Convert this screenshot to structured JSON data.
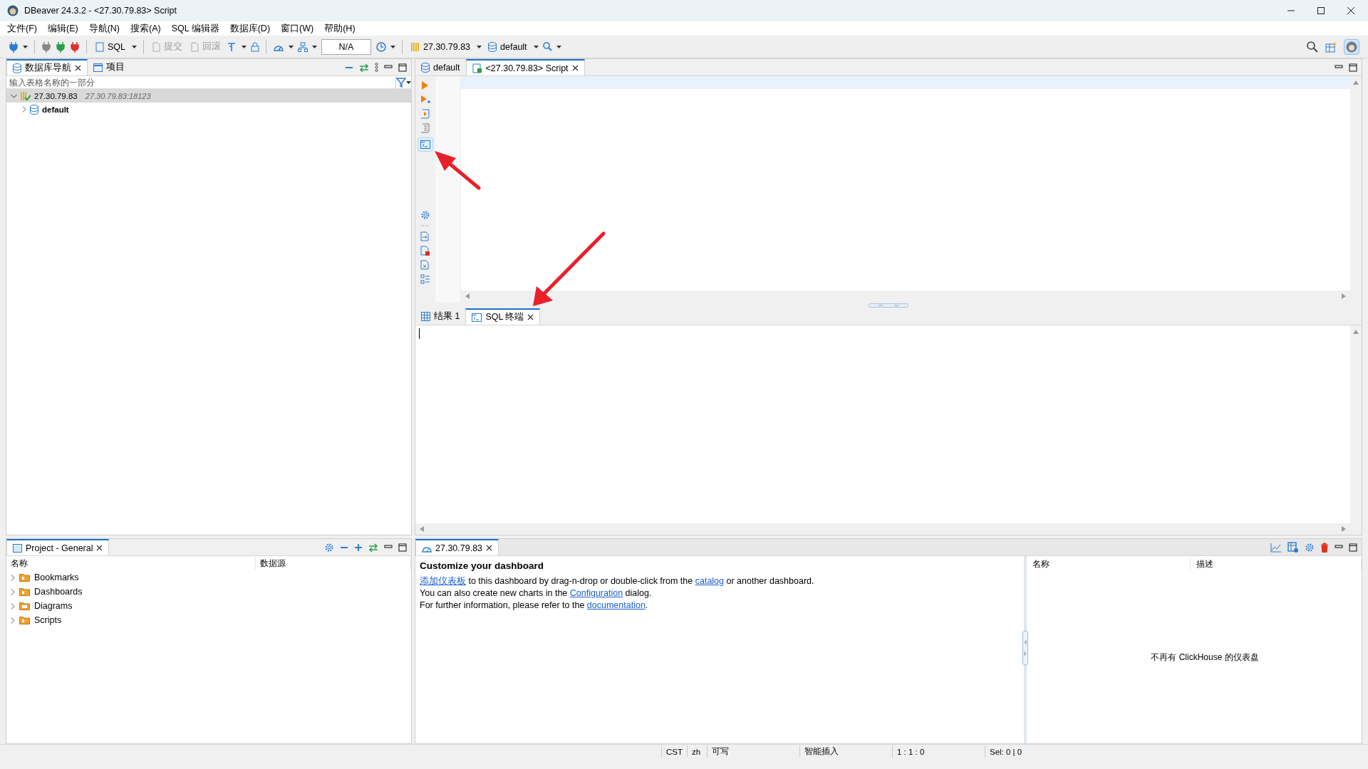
{
  "window": {
    "title": "DBeaver 24.3.2 - <27.30.79.83> Script"
  },
  "menu": [
    "文件(F)",
    "编辑(E)",
    "导航(N)",
    "搜索(A)",
    "SQL 编辑器",
    "数据库(D)",
    "窗口(W)",
    "帮助(H)"
  ],
  "toolbar": {
    "sql_button": "SQL",
    "commit": {
      "label": "提交",
      "disabled": true
    },
    "rollback": {
      "label": "回滚",
      "disabled": true
    },
    "transaction_mode": "N/A",
    "connection": "27.30.79.83",
    "schema": "default"
  },
  "navigator": {
    "tabs": [
      {
        "label": "数据库导航",
        "selected": true
      },
      {
        "label": "项目",
        "selected": false
      }
    ],
    "filter": {
      "placeholder": "输入表格名称的一部分"
    },
    "tree": [
      {
        "label": "27.30.79.83",
        "detail": "27.30.79.83:18123",
        "expanded": true,
        "selected": true,
        "children": [
          {
            "label": "default",
            "expanded": false,
            "selected": false
          }
        ]
      }
    ]
  },
  "editor": {
    "tabs": [
      {
        "label": "default",
        "selected": false
      },
      {
        "label": "<27.30.79.83> Script",
        "selected": true
      }
    ]
  },
  "results": {
    "tabs": [
      {
        "label": "结果 1",
        "selected": false
      },
      {
        "label": "SQL 终端",
        "selected": true
      }
    ]
  },
  "projects": {
    "title": "Project - General",
    "columns": [
      "名称",
      "数据源"
    ],
    "items": [
      {
        "label": "Bookmarks"
      },
      {
        "label": "Dashboards"
      },
      {
        "label": "Diagrams"
      },
      {
        "label": "Scripts"
      }
    ]
  },
  "dashboard": {
    "tab": "27.30.79.83",
    "heading": "Customize your dashboard",
    "lines": [
      [
        {
          "kind": "link",
          "text": "添加仪表板"
        },
        {
          "kind": "text",
          "text": " to this dashboard by drag-n-drop or double-click from the "
        },
        {
          "kind": "link",
          "text": "catalog"
        },
        {
          "kind": "text",
          "text": " or another dashboard."
        }
      ],
      [
        {
          "kind": "text",
          "text": "You can also create new charts in the "
        },
        {
          "kind": "link",
          "text": "Configuration"
        },
        {
          "kind": "text",
          "text": " dialog."
        }
      ],
      [
        {
          "kind": "text",
          "text": "For further information, please refer to the "
        },
        {
          "kind": "link",
          "text": "documentation"
        },
        {
          "kind": "text",
          "text": "."
        }
      ]
    ],
    "list": {
      "columns": [
        "名称",
        "描述"
      ],
      "empty_message": "不再有 ClickHouse 的仪表盘"
    }
  },
  "status_bar": [
    "CST",
    "zh",
    "可写",
    "智能插入",
    "1 : 1 : 0",
    "Sel: 0 | 0"
  ]
}
